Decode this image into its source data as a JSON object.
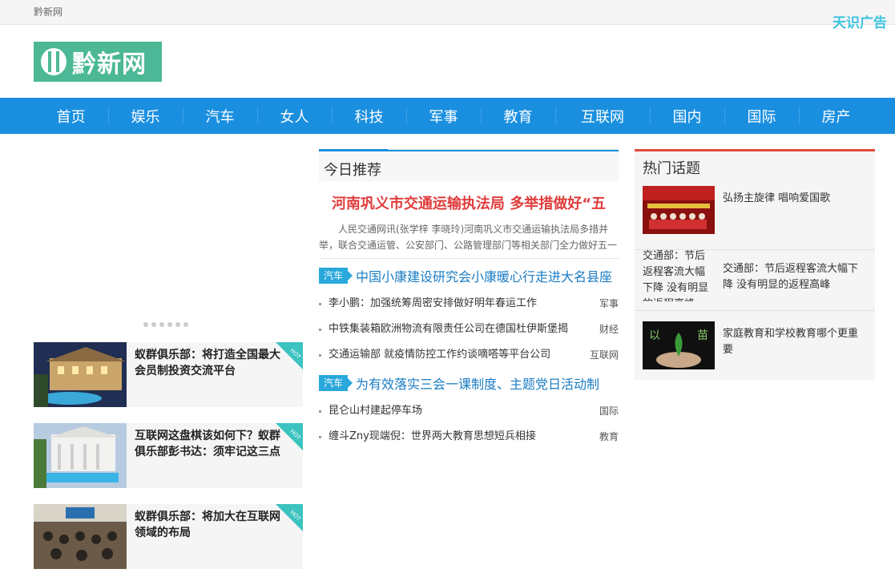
{
  "topbar": {
    "site_name": "黔新网",
    "ad_label": "天识广告"
  },
  "logo": {
    "text": "黔新网"
  },
  "nav": {
    "items": [
      "首页",
      "娱乐",
      "汽车",
      "女人",
      "科技",
      "军事",
      "教育",
      "互联网",
      "国内",
      "国际",
      "房产"
    ]
  },
  "slider": {
    "dots": 6
  },
  "left_cards": [
    {
      "title": "蚁群俱乐部：将打造全国最大会员制投资交流平台",
      "badge": "HOT"
    },
    {
      "title": "互联网这盘棋该如何下？蚁群俱乐部彭书达：须牢记这三点",
      "badge": "HOT"
    },
    {
      "title": "蚁群俱乐部：将加大在互联网领域的布局",
      "badge": "HOT"
    }
  ],
  "recommend": {
    "heading": "今日推荐",
    "headline": "河南巩义市交通运输执法局 多举措做好“五",
    "summary": "人民交通网讯(张学梓 李晓玲)河南巩义市交通运输执法局多措并举，联合交通运管、公安部门、公路管理部门等相关部门全力做好五一",
    "groups": [
      {
        "tag": "汽车",
        "title": "中国小康建设研究会小康暖心行走进大名县座",
        "items": [
          {
            "text": "李小鹏：加强统筹周密安排做好明年春运工作",
            "tag": "军事"
          },
          {
            "text": "中铁集装箱欧洲物流有限责任公司在德国杜伊斯堡揭",
            "tag": "财经"
          },
          {
            "text": "交通运输部 就疫情防控工作约谈嘀嗒等平台公司",
            "tag": "互联网"
          }
        ]
      },
      {
        "tag": "汽车",
        "title": "为有效落实三会一课制度、主题党日活动制",
        "items": [
          {
            "text": "昆仑山村建起停车场",
            "tag": "国际"
          },
          {
            "text": "缠斗Zny现端倪：世界两大教育思想短兵相接",
            "tag": "教育"
          }
        ]
      }
    ]
  },
  "hot_topics": {
    "heading": "热门话题",
    "items": [
      {
        "title": "弘扬主旋律 唱响爱国歌",
        "image_alt": ""
      },
      {
        "title": "交通部：节后返程客流大幅下降 没有明显的返程高峰",
        "image_alt": "交通部：节后返程客流大幅下降 没有明显的返程高峰"
      },
      {
        "title": "家庭教育和学校教育哪个更重要",
        "image_alt": ""
      }
    ]
  }
}
